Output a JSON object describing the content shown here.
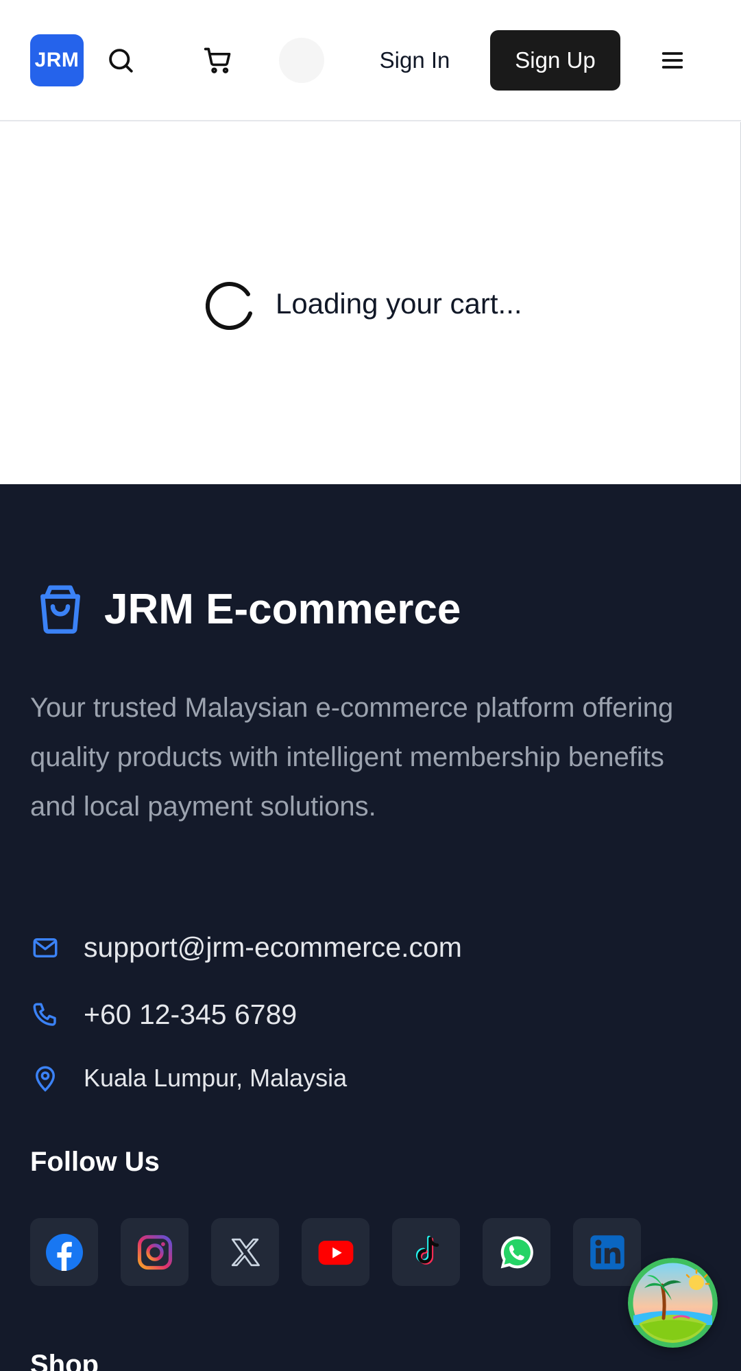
{
  "header": {
    "logo_text": "JRM",
    "sign_in": "Sign In",
    "sign_up": "Sign Up",
    "icons": [
      "search-icon",
      "cart-icon",
      "menu-icon"
    ]
  },
  "loading": {
    "text": "Loading your cart..."
  },
  "footer": {
    "brand_name": "JRM E-commerce",
    "tagline": "Your trusted Malaysian e-commerce platform offering quality products with intelligent membership benefits and local payment solutions.",
    "email": "support@jrm-ecommerce.com",
    "phone": "+60 12-345 6789",
    "location": "Kuala Lumpur, Malaysia",
    "follow_title": "Follow Us",
    "socials": [
      "facebook-icon",
      "instagram-icon",
      "x-icon",
      "youtube-icon",
      "tiktok-icon",
      "whatsapp-icon",
      "linkedin-icon"
    ],
    "shop_title": "Shop",
    "colors": {
      "background": "#141a2a",
      "accent": "#3b82f6",
      "muted_text": "#9ca3af"
    }
  },
  "floating_button": {
    "icon": "island-icon"
  }
}
